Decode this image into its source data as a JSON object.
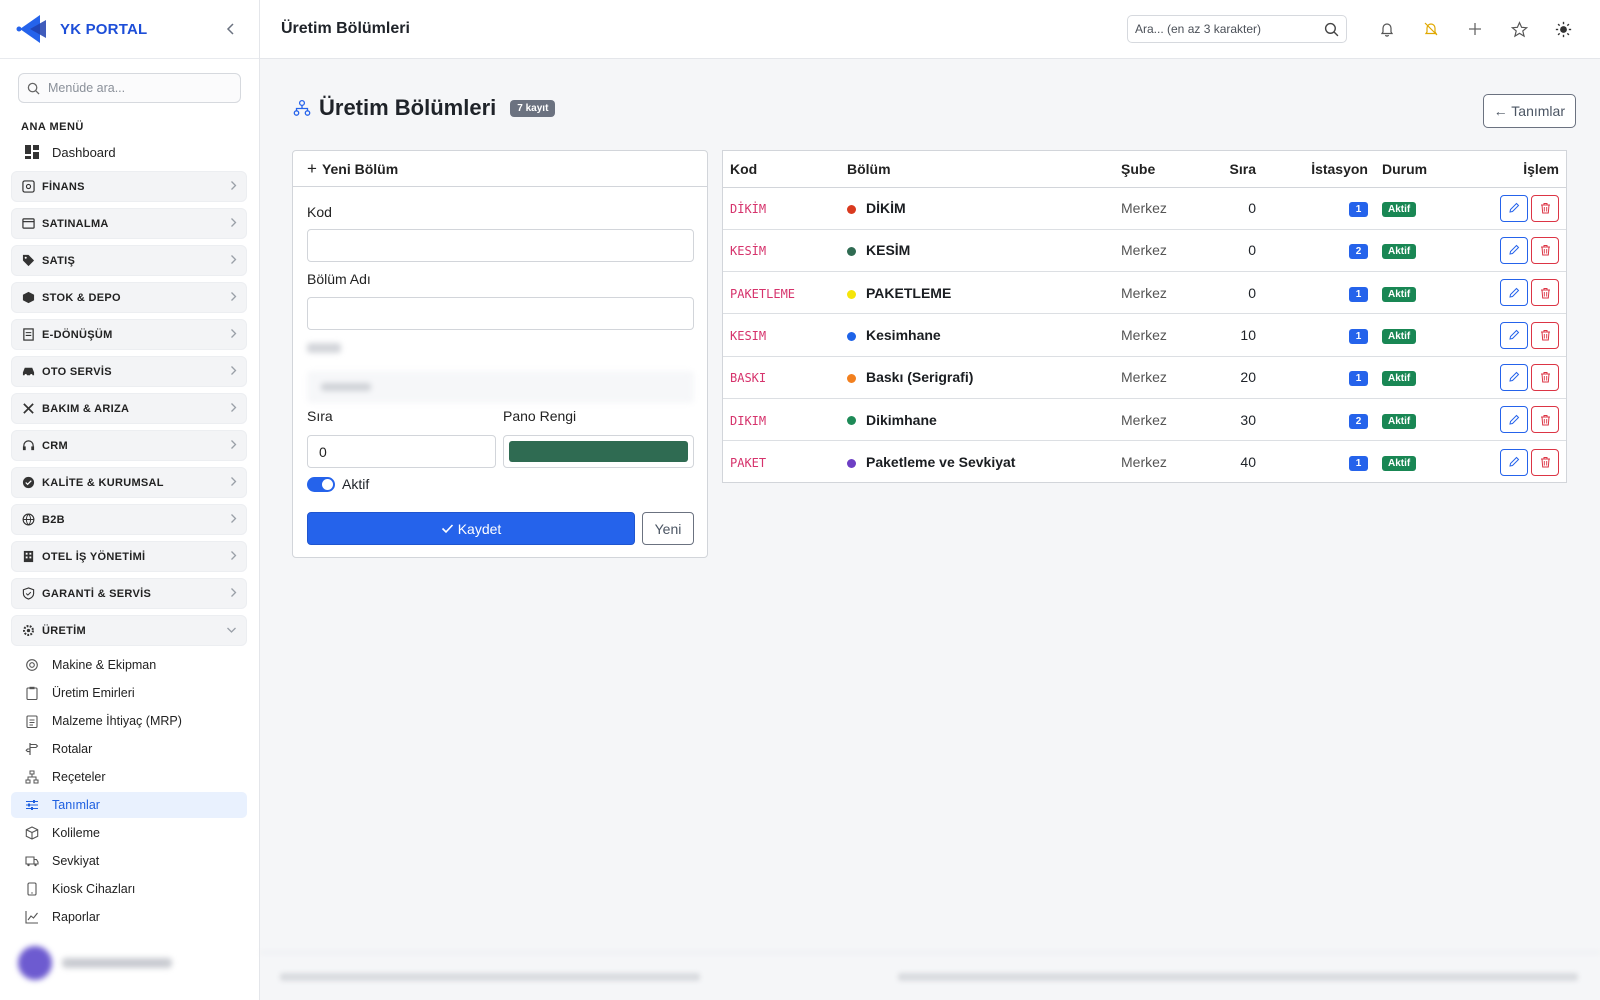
{
  "brand": {
    "name": "YK PORTAL"
  },
  "sidebar": {
    "search_placeholder": "Menüde ara...",
    "section_title": "ANA MENÜ",
    "dashboard": "Dashboard",
    "groups": [
      {
        "label": "FİNANS",
        "icon": "finance-icon"
      },
      {
        "label": "SATINALMA",
        "icon": "purchase-icon"
      },
      {
        "label": "SATIŞ",
        "icon": "tag-icon"
      },
      {
        "label": "STOK & DEPO",
        "icon": "box-icon"
      },
      {
        "label": "E-DÖNÜŞÜM",
        "icon": "document-icon"
      },
      {
        "label": "OTO SERVİS",
        "icon": "car-icon"
      },
      {
        "label": "BAKIM & ARIZA",
        "icon": "tools-icon"
      },
      {
        "label": "CRM",
        "icon": "headset-icon"
      },
      {
        "label": "KALİTE & KURUMSAL",
        "icon": "badge-check-icon"
      },
      {
        "label": "B2B",
        "icon": "globe-icon"
      },
      {
        "label": "OTEL İŞ YÖNETİMİ",
        "icon": "building-icon"
      },
      {
        "label": "GARANTİ & SERVİS",
        "icon": "shield-icon"
      },
      {
        "label": "ÜRETİM",
        "icon": "gear-icon"
      }
    ],
    "production_items": [
      {
        "label": "Makine & Ekipman",
        "icon": "machine-icon"
      },
      {
        "label": "Üretim Emirleri",
        "icon": "clipboard-icon"
      },
      {
        "label": "Malzeme İhtiyaç (MRP)",
        "icon": "clipboard-list-icon"
      },
      {
        "label": "Rotalar",
        "icon": "signpost-icon"
      },
      {
        "label": "Reçeteler",
        "icon": "hierarchy-icon"
      },
      {
        "label": "Tanımlar",
        "icon": "sliders-icon"
      },
      {
        "label": "Kolileme",
        "icon": "package-icon"
      },
      {
        "label": "Sevkiyat",
        "icon": "truck-icon"
      },
      {
        "label": "Kiosk Cihazları",
        "icon": "tablet-icon"
      },
      {
        "label": "Raporlar",
        "icon": "chart-line-icon"
      }
    ],
    "active_item": "Tanımlar"
  },
  "header": {
    "title": "Üretim Bölümleri",
    "search_placeholder": "Ara... (en az 3 karakter)"
  },
  "page": {
    "title": "Üretim Bölümleri",
    "count_badge": "7 kayıt",
    "back_button": "← Tanımlar"
  },
  "form": {
    "title": "Yeni Bölüm",
    "code_label": "Kod",
    "code_value": "",
    "name_label": "Bölüm Adı",
    "name_value": "",
    "order_label": "Sıra",
    "order_value": "0",
    "color_label": "Pano Rengi",
    "color_value": "#2f6b52",
    "active_label": "Aktif",
    "save_button": "Kaydet",
    "new_button": "Yeni"
  },
  "table": {
    "headers": [
      "Kod",
      "Bölüm",
      "Şube",
      "Sıra",
      "İstasyon",
      "Durum",
      "İşlem"
    ],
    "rows": [
      {
        "code": "DİKİM",
        "name": "DİKİM",
        "color": "#d93a1f",
        "branch": "Merkez",
        "order": "0",
        "stations": "1",
        "status": "Aktif"
      },
      {
        "code": "KESİM",
        "name": "KESİM",
        "color": "#2f6b52",
        "branch": "Merkez",
        "order": "0",
        "stations": "2",
        "status": "Aktif"
      },
      {
        "code": "PAKETLEME",
        "name": "PAKETLEME",
        "color": "#f5e50a",
        "branch": "Merkez",
        "order": "0",
        "stations": "1",
        "status": "Aktif"
      },
      {
        "code": "KESIM",
        "name": "Kesimhane",
        "color": "#1e63e8",
        "branch": "Merkez",
        "order": "10",
        "stations": "1",
        "status": "Aktif"
      },
      {
        "code": "BASKI",
        "name": "Baskı (Serigrafi)",
        "color": "#f2801f",
        "branch": "Merkez",
        "order": "20",
        "stations": "1",
        "status": "Aktif"
      },
      {
        "code": "DIKIM",
        "name": "Dikimhane",
        "color": "#1e8a57",
        "branch": "Merkez",
        "order": "30",
        "stations": "2",
        "status": "Aktif"
      },
      {
        "code": "PAKET",
        "name": "Paketleme ve Sevkiyat",
        "color": "#6d3fc4",
        "branch": "Merkez",
        "order": "40",
        "stations": "1",
        "status": "Aktif"
      }
    ]
  }
}
